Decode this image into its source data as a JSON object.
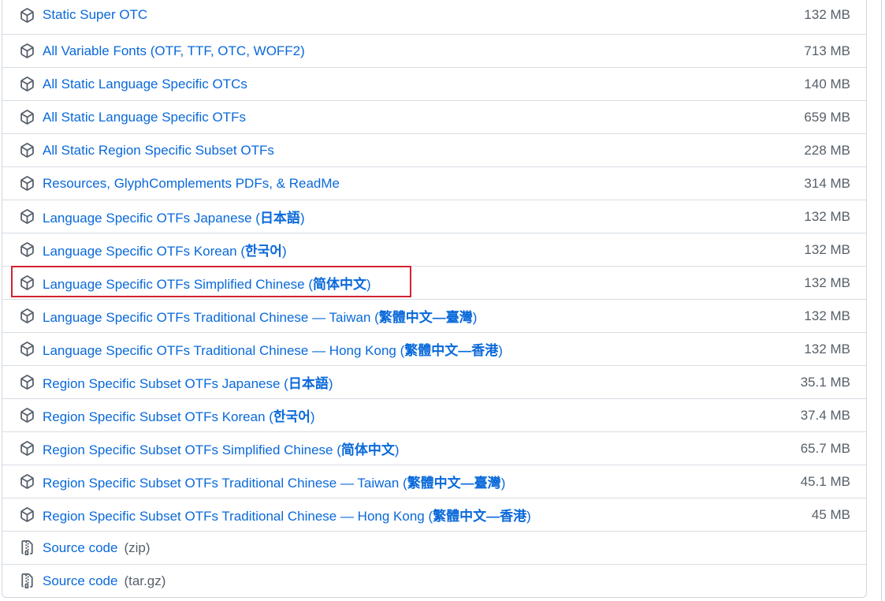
{
  "assets": [
    {
      "name": "Static Super OTC",
      "size": "132 MB",
      "icon": "package-icon"
    },
    {
      "name": "All Variable Fonts (OTF, TTF, OTC, WOFF2)",
      "size": "713 MB",
      "icon": "package-icon"
    },
    {
      "name": "All Static Language Specific OTCs",
      "size": "140 MB",
      "icon": "package-icon"
    },
    {
      "name": "All Static Language Specific OTFs",
      "size": "659 MB",
      "icon": "package-icon"
    },
    {
      "name": "All Static Region Specific Subset OTFs",
      "size": "228 MB",
      "icon": "package-icon"
    },
    {
      "name": "Resources, GlyphComplements PDFs, & ReadMe",
      "size": "314 MB",
      "icon": "package-icon"
    },
    {
      "name_prefix": "Language Specific OTFs Japanese (",
      "name_cjk": "日本語",
      "name_suffix": ")",
      "size": "132 MB",
      "icon": "package-icon"
    },
    {
      "name_prefix": "Language Specific OTFs Korean (",
      "name_cjk": "한국어",
      "name_suffix": ")",
      "size": "132 MB",
      "icon": "package-icon"
    },
    {
      "name_prefix": "Language Specific OTFs Simplified Chinese (",
      "name_cjk": "简体中文",
      "name_suffix": ")",
      "size": "132 MB",
      "icon": "package-icon",
      "highlighted": true
    },
    {
      "name_prefix": "Language Specific OTFs Traditional Chinese — Taiwan (",
      "name_cjk": "繁體中文—臺灣",
      "name_suffix": ")",
      "size": "132 MB",
      "icon": "package-icon"
    },
    {
      "name_prefix": "Language Specific OTFs Traditional Chinese — Hong Kong (",
      "name_cjk": "繁體中文—香港",
      "name_suffix": ")",
      "size": "132 MB",
      "icon": "package-icon"
    },
    {
      "name_prefix": "Region Specific Subset OTFs Japanese (",
      "name_cjk": "日本語",
      "name_suffix": ")",
      "size": "35.1 MB",
      "icon": "package-icon"
    },
    {
      "name_prefix": "Region Specific Subset OTFs Korean (",
      "name_cjk": "한국어",
      "name_suffix": ")",
      "size": "37.4 MB",
      "icon": "package-icon"
    },
    {
      "name_prefix": "Region Specific Subset OTFs Simplified Chinese (",
      "name_cjk": "简体中文",
      "name_suffix": ")",
      "size": "65.7 MB",
      "icon": "package-icon"
    },
    {
      "name_prefix": "Region Specific Subset OTFs Traditional Chinese — Taiwan (",
      "name_cjk": "繁體中文—臺灣",
      "name_suffix": ")",
      "size": "45.1 MB",
      "icon": "package-icon"
    },
    {
      "name_prefix": "Region Specific Subset OTFs Traditional Chinese — Hong Kong (",
      "name_cjk": "繁體中文—香港",
      "name_suffix": ")",
      "size": "45 MB",
      "icon": "package-icon"
    }
  ],
  "source_code": [
    {
      "label": "Source code",
      "format": "(zip)",
      "icon": "file-zip-icon"
    },
    {
      "label": "Source code",
      "format": "(tar.gz)",
      "icon": "file-zip-icon"
    }
  ],
  "colors": {
    "link": "#0969da",
    "muted": "#57606a",
    "border": "#d0d7de",
    "highlight": "#d1242f"
  }
}
